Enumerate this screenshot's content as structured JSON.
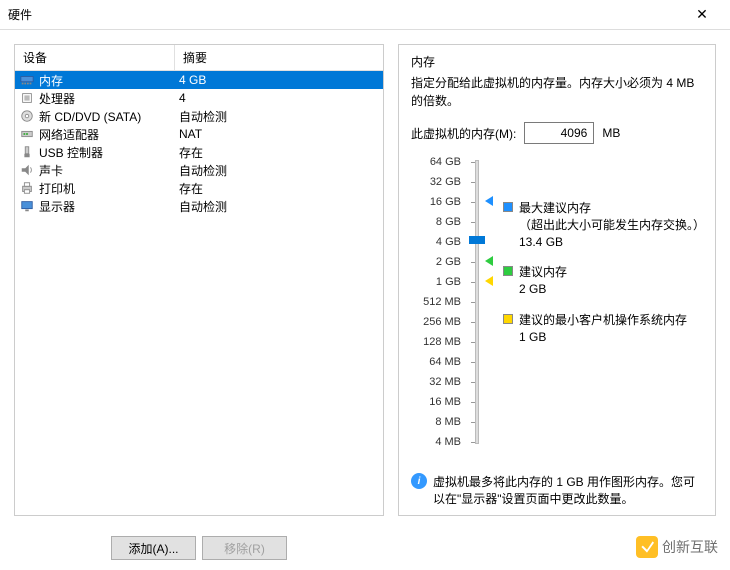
{
  "title": "硬件",
  "columns": {
    "device": "设备",
    "summary": "摘要"
  },
  "devices": [
    {
      "icon": "memory",
      "label": "内存",
      "summary": "4 GB",
      "selected": true
    },
    {
      "icon": "cpu",
      "label": "处理器",
      "summary": "4"
    },
    {
      "icon": "cd",
      "label": "新 CD/DVD (SATA)",
      "summary": "自动检测"
    },
    {
      "icon": "network",
      "label": "网络适配器",
      "summary": "NAT"
    },
    {
      "icon": "usb",
      "label": "USB 控制器",
      "summary": "存在"
    },
    {
      "icon": "sound",
      "label": "声卡",
      "summary": "自动检测"
    },
    {
      "icon": "printer",
      "label": "打印机",
      "summary": "存在"
    },
    {
      "icon": "display",
      "label": "显示器",
      "summary": "自动检测"
    }
  ],
  "memory": {
    "section": "内存",
    "desc": "指定分配给此虚拟机的内存量。内存大小必须为 4 MB 的倍数。",
    "input_label": "此虚拟机的内存(M):",
    "value": "4096",
    "unit": "MB",
    "ticks": [
      "64 GB",
      "32 GB",
      "16 GB",
      "8 GB",
      "4 GB",
      "2 GB",
      "1 GB",
      "512 MB",
      "256 MB",
      "128 MB",
      "64 MB",
      "32 MB",
      "16 MB",
      "8 MB",
      "4 MB"
    ],
    "legend": {
      "max_rec": {
        "title": "最大建议内存",
        "note": "（超出此大小可能发生内存交换。）",
        "value": "13.4 GB"
      },
      "rec": {
        "title": "建议内存",
        "value": "2 GB"
      },
      "min_rec": {
        "title": "建议的最小客户机操作系统内存",
        "value": "1 GB"
      }
    },
    "info": "虚拟机最多将此内存的 1 GB 用作图形内存。您可以在\"显示器\"设置页面中更改此数量。"
  },
  "buttons": {
    "add": "添加(A)...",
    "remove": "移除(R)"
  },
  "watermark": "创新互联"
}
